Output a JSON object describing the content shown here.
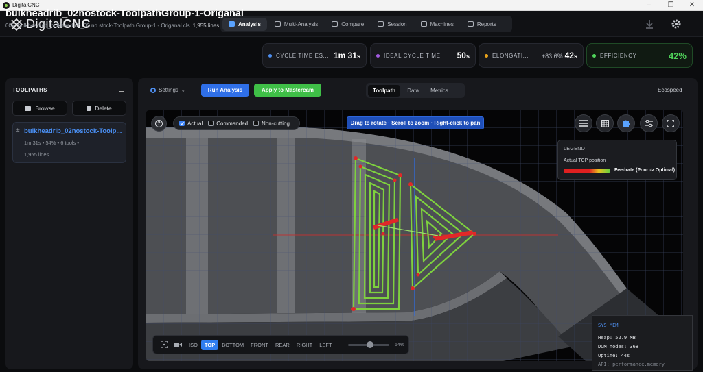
{
  "window": {
    "title": "DigitalCNC"
  },
  "app": {
    "logo_prefix": "Digital",
    "logo_suffix": "CNC"
  },
  "nav": {
    "tabs": [
      {
        "label": "Analysis",
        "active": true
      },
      {
        "label": "Multi-Analysis"
      },
      {
        "label": "Compare"
      },
      {
        "label": "Session"
      },
      {
        "label": "Machines"
      },
      {
        "label": "Reports"
      }
    ]
  },
  "header": {
    "title": "bulkheadrib_02nostock-ToolpathGroup-1-Origanal",
    "subtitle": "002_bulkhead rib_bulkhead rib_02 no stock-Toolpath Group-1 - Origanal.cls",
    "lines": "1,955 lines"
  },
  "metrics": {
    "cycle": {
      "label": "CYCLE TIME ES...",
      "value_main": "1m 31",
      "value_unit": "s",
      "color": "#4e8ff0"
    },
    "ideal": {
      "label": "IDEAL CYCLE TIME",
      "value_main": "50",
      "value_unit": "s",
      "color": "#a35be0"
    },
    "elong": {
      "label": "ELONGATI...",
      "pct": "+83.6%",
      "value_main": "42",
      "value_unit": "s",
      "color": "#e8a21a"
    },
    "eff": {
      "label": "EFFICIENCY",
      "value": "42%",
      "color": "#4fd35a"
    }
  },
  "sidebar": {
    "title": "TOOLPATHS",
    "browse": "Browse",
    "delete": "Delete",
    "items": [
      {
        "hash": "#",
        "name": "bulkheadrib_02nostock-Toolp...",
        "meta": "1m 31s  •  54%  •  6 tools  •",
        "lines": "1,955 lines"
      }
    ]
  },
  "toolbar": {
    "settings": "Settings",
    "run": "Run Analysis",
    "apply": "Apply to Mastercam",
    "view_tabs": [
      "Toolpath",
      "Data",
      "Metrics"
    ],
    "active_view": "Toolpath",
    "ecospeed": "Ecospeed"
  },
  "viewport": {
    "filters": [
      "Actual",
      "Commanded",
      "Non-cutting"
    ],
    "actual_checked": true,
    "hint": "Drag to rotate · Scroll to zoom · Right-click to pan",
    "icons": [
      "list-icon",
      "grid-icon",
      "puzzle-icon",
      "sliders-icon",
      "fullscreen-icon"
    ]
  },
  "legend": {
    "title": "LEGEND",
    "subtitle": "Actual TCP position",
    "bar_label": "Feedrate (Poor -> Optimal)"
  },
  "viewbar": {
    "views": [
      "ISO",
      "TOP",
      "BOTTOM",
      "FRONT",
      "REAR",
      "RIGHT",
      "LEFT"
    ],
    "active": "TOP",
    "zoom_pct": "54%",
    "zoom_value": 0.54
  },
  "sysmem": {
    "title": "SYS MEM",
    "heap": "Heap: 52.9 MB",
    "dom": "DOM nodes: 368",
    "uptime": "Uptime: 44s",
    "api": "API: performance.memory"
  }
}
